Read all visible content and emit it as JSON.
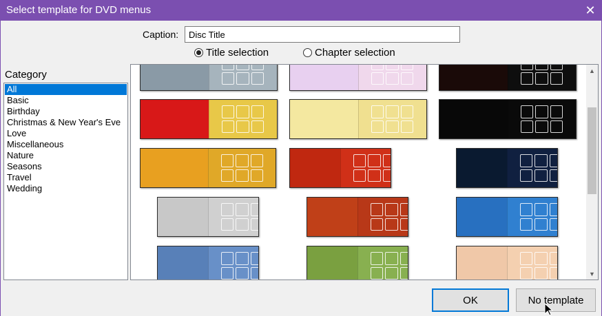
{
  "window": {
    "title": "Select template for DVD menus",
    "close_glyph": "✕"
  },
  "caption": {
    "label": "Caption:",
    "value": "Disc Title"
  },
  "selection": {
    "title_label": "Title selection",
    "chapter_label": "Chapter selection",
    "selected": "title"
  },
  "category": {
    "label": "Category",
    "selected": "All",
    "items": [
      "All",
      "Basic",
      "Birthday",
      "Christmas & New Year's Eve",
      "Love",
      "Miscellaneous",
      "Nature",
      "Seasons",
      "Travel",
      "Wedding"
    ]
  },
  "templates": [
    {
      "theme": "grey-gradient",
      "left": "#8a9aa6",
      "right": "#a6b4bd"
    },
    {
      "theme": "pink-party",
      "left": "#e8d0f0",
      "right": "#f0d8ec"
    },
    {
      "theme": "birthday-cake",
      "left": "#1a0a08",
      "right": "#0e0e0e"
    },
    {
      "theme": "christmas-tree-red",
      "left": "#d81818",
      "right": "#e8c848"
    },
    {
      "theme": "christmas-tree-yellow",
      "left": "#f4e8a0",
      "right": "#f0e090"
    },
    {
      "theme": "fireworks",
      "left": "#080808",
      "right": "#0a0a0a"
    },
    {
      "theme": "golden-heart",
      "left": "#e8a020",
      "right": "#e0a828"
    },
    {
      "theme": "red-heart",
      "left": "#c02810",
      "right": "#d03018"
    },
    {
      "theme": "dark-blue-swirl",
      "left": "#0a1a30",
      "right": "#102040"
    },
    {
      "theme": "penguin",
      "left": "#c8c8c8",
      "right": "#d0d0d0"
    },
    {
      "theme": "red-sunset-clouds",
      "left": "#c04018",
      "right": "#b83818"
    },
    {
      "theme": "blue-winter-forest",
      "left": "#2870c0",
      "right": "#3080d0"
    },
    {
      "theme": "snowy-forest",
      "left": "#5880b8",
      "right": "#6890c8"
    },
    {
      "theme": "spring-park",
      "left": "#7aa040",
      "right": "#88b050"
    },
    {
      "theme": "peach-pattern",
      "left": "#f0c8a8",
      "right": "#f4d0b0"
    }
  ],
  "buttons": {
    "ok": "OK",
    "no_template": "No template"
  },
  "colors": {
    "titlebar": "#7b4fb0",
    "selection": "#0078d7"
  }
}
